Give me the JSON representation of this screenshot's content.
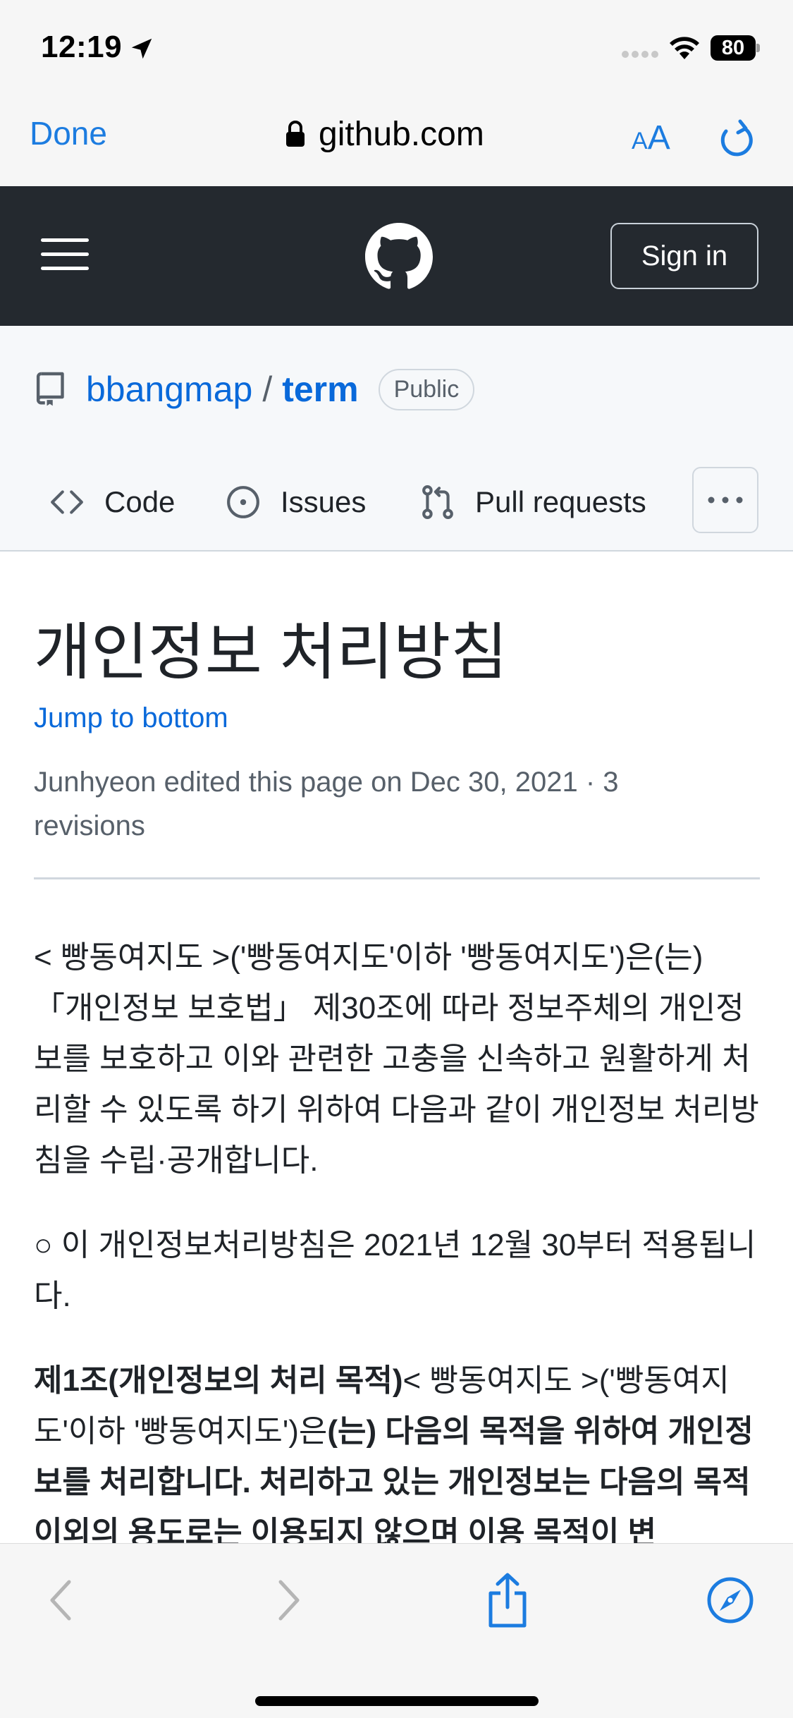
{
  "status_bar": {
    "time": "12:19",
    "battery": "80",
    "icons": [
      "location-arrow-icon",
      "signal-dots-icon",
      "wifi-icon",
      "battery-icon"
    ]
  },
  "browser": {
    "done_label": "Done",
    "url": "github.com",
    "text_size_small": "A",
    "text_size_large": "A",
    "accent_color": "#1c7ce0"
  },
  "github_header": {
    "sign_in_label": "Sign in",
    "background": "#24292f"
  },
  "repo": {
    "owner": "bbangmap",
    "separator": "/",
    "name": "term",
    "visibility": "Public",
    "tabs": [
      {
        "label": "Code",
        "icon": "code-icon"
      },
      {
        "label": "Issues",
        "icon": "issue-circle-icon"
      },
      {
        "label": "Pull requests",
        "icon": "pull-request-icon"
      }
    ],
    "link_color": "#0969da"
  },
  "wiki": {
    "title": "개인정보 처리방침",
    "jump_link": "Jump to bottom",
    "edit_meta": "Junhyeon edited this page on Dec 30, 2021 · 3 revisions",
    "paragraph_1": "< 빵동여지도 >('빵동여지도'이하 '빵동여지도')은(는) 「개인정보 보호법」 제30조에 따라 정보주체의 개인정보를 보호하고 이와 관련한 고충을 신속하고 원활하게 처리할 수 있도록 하기 위하여 다음과 같이 개인정보 처리방침을 수립·공개합니다.",
    "paragraph_2": "○ 이 개인정보처리방침은 2021년 12월 30부터 적용됩니다.",
    "article_1_heading": "제1조(개인정보의 처리 목적)",
    "article_1_text_a": "< 빵동여지도 >('빵동여지도'이하 '빵동여지도')은",
    "article_1_text_b": "(는) 다음의 목적을 위하여 개인정보를 처리합니다. 처리하고 있는 개인정보는 다음의 목적 이외의 용도로는 이용되지 않으며 이용 목적이 변"
  },
  "toolbar": {
    "icons": [
      "back-icon",
      "forward-icon",
      "share-icon",
      "safari-compass-icon"
    ]
  }
}
